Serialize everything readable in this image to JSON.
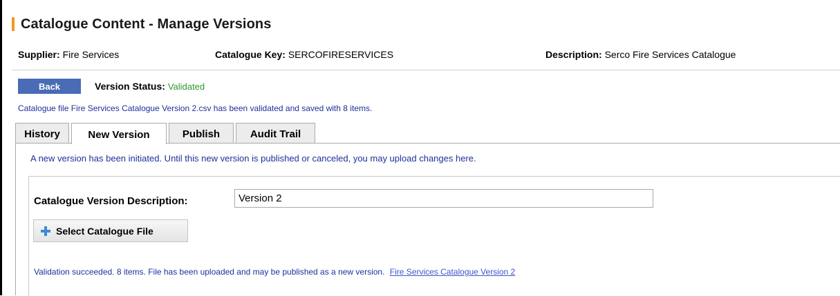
{
  "page": {
    "title": "Catalogue Content - Manage Versions"
  },
  "info": {
    "supplier_label": "Supplier:",
    "supplier_value": "Fire Services",
    "key_label": "Catalogue Key:",
    "key_value": "SERCOFIRESERVICES",
    "description_label": "Description:",
    "description_value": "Serco Fire Services Catalogue"
  },
  "toolbar": {
    "back_label": "Back",
    "status_label": "Version Status:",
    "status_value": "Validated"
  },
  "messages": {
    "saved": "Catalogue file Fire Services Catalogue Version 2.csv has been validated and saved with 8 items."
  },
  "tabs": [
    {
      "label": "History",
      "active": false
    },
    {
      "label": "New Version",
      "active": true
    },
    {
      "label": "Publish",
      "active": false
    },
    {
      "label": "Audit Trail",
      "active": false
    }
  ],
  "new_version": {
    "intro": "A new version has been initiated. Until this new version is published or canceled, you may upload changes here.",
    "desc_label": "Catalogue Version Description:",
    "desc_value": "Version 2",
    "select_label": "Select Catalogue File",
    "validation_text": "Validation succeeded. 8 items. File has been uploaded and may be published as a new version.",
    "file_link": "Fire Services Catalogue Version 2"
  },
  "colors": {
    "accent": "#f29a1f",
    "button": "#4a6bb5",
    "status_ok": "#2a9a2a",
    "message": "#1f2f9c"
  }
}
